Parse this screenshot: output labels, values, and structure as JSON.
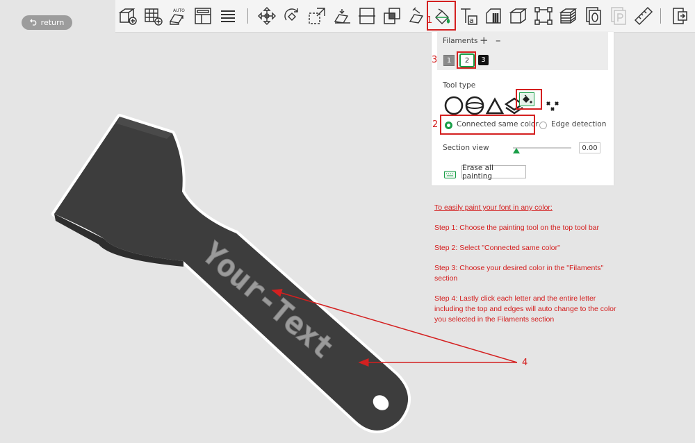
{
  "nav": {
    "return_label": "return"
  },
  "toolbar": {
    "icons": [
      "add-cube-icon",
      "arrange-grid-icon",
      "auto-orient-icon",
      "plate-layout-icon",
      "layers-list-icon",
      "move-icon",
      "rotate-icon",
      "scale-icon",
      "lay-on-face-icon",
      "cut-icon",
      "boolean-icon",
      "support-paint-icon",
      "color-paint-icon",
      "text-tool-icon",
      "seam-paint-icon",
      "cube-view-icon",
      "fit-view-icon",
      "slice-stack-icon",
      "copy-object-icon",
      "paste-object-icon",
      "measure-icon",
      "assembly-view-icon"
    ]
  },
  "panel": {
    "filaments_label": "Filaments",
    "add_symbol": "+",
    "remove_symbol": "–",
    "swatches": [
      "1",
      "2",
      "3"
    ],
    "tool_type_label": "Tool type",
    "tools": [
      "circle-tool-icon",
      "sphere-tool-icon",
      "triangle-tool-icon",
      "height-range-icon",
      "fill-bucket-icon",
      "gap-fill-icon"
    ],
    "option_connected": "Connected same color",
    "option_edge": "Edge detection",
    "section_view_label": "Section view",
    "section_value": "0.00",
    "section_slider_fraction": 0,
    "erase_label": "Erase all painting",
    "accent_color": "#1a9e48"
  },
  "annotations": {
    "numbers": [
      "1",
      "2",
      "3",
      "4"
    ],
    "highlight_color": "#d42020"
  },
  "instructions": {
    "title": "To easily paint your font in any color:",
    "steps": [
      "Step 1: Choose the painting tool on the top tool bar",
      "Step 2: Select \"Connected same color\"",
      "Step 3: Choose your desired color in the \"Filaments\" section",
      "Step 4: Lastly click each letter and the entire letter including the top and edges will auto change to the color you selected in the Filaments section"
    ]
  },
  "model": {
    "embossed_text": "Your-Text",
    "body_color": "#3d3d3d",
    "text_color": "#9a9a9a"
  }
}
